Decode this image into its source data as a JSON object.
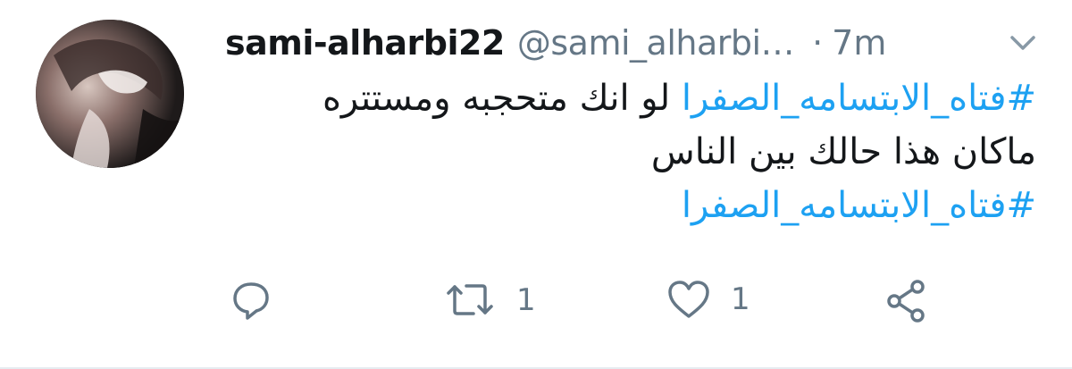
{
  "tweet": {
    "display_name": "sami-alharbi22",
    "handle": "@sami_alharbi…",
    "separator": "·",
    "time": "7m",
    "body": {
      "line1_hashtag": "#فتاه_الابتسامه_الصفرا",
      "line1_text": "لو انك متحجبه ومستتره",
      "line2_text": "ماكان هذا حالك بين الناس",
      "line3_hashtag": "#فتاه_الابتسامه_الصفرا"
    },
    "actions": {
      "reply_icon": "reply-icon",
      "retweet_icon": "retweet-icon",
      "retweet_count": "1",
      "like_icon": "heart-icon",
      "like_count": "1",
      "share_icon": "share-icon"
    }
  },
  "colors": {
    "hashtag": "#1da1f2",
    "secondary_text": "#657786",
    "primary_text": "#14171a"
  }
}
